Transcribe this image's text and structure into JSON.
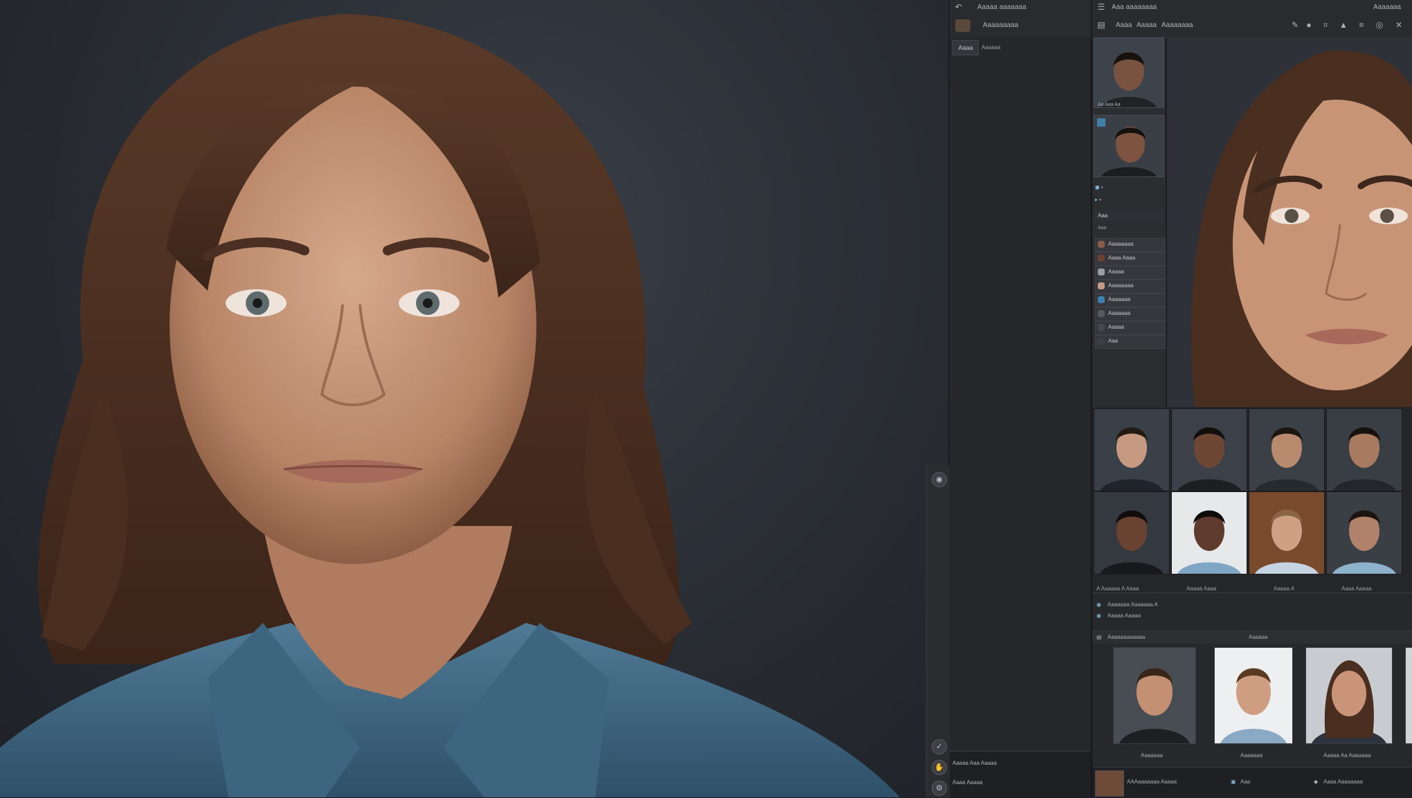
{
  "topbar_left": {
    "title": "Aaaaa aaaaaaa",
    "subtitle": "Aaaaaaaaa"
  },
  "topbar_right": {
    "title": "Aaa aaaaaaaa",
    "tab_1": "Aaaa",
    "tab_2": "Aaaaa",
    "tab_3": "Aaaaaaaa",
    "right_text": "Aaaaaaa"
  },
  "side_panel": {
    "tab_label": "Aaaa",
    "tab_caption": "Aaaaaa",
    "footer_line1": "Aaaaa Aaa Aaaaa",
    "footer_line2": "Aaaa Aaaaa"
  },
  "thumb_col": {
    "thumb1_caption": "Aa Aaa Aa",
    "list_header": "Aaa",
    "list_sub": "Aaa",
    "list_items": [
      "Aaaaaaaa",
      "Aaaa Aaaa",
      "Aaaaa",
      "Aaaaaaaa",
      "Aaaaaaa",
      "Aaaaaaa",
      "Aaaaa",
      "Aaa"
    ]
  },
  "face_grid": {
    "captions": [
      "A Aaaaaa A Aaaa",
      "Aaaaa Aaaa",
      "Aaaaa A",
      "Aaaa Aaaaa"
    ]
  },
  "lower_panel": {
    "info_line1": "Aaaaaaa Aaaaaaa A",
    "info_line2": "Aaaaa Aaaaa",
    "section_title": "Aaaaaaaaaaaa",
    "section_center": "Aaaaaa",
    "card_captions": [
      "Aaaaaaa",
      "Aaaaaaa",
      "Aaaaa Aa Aaaaaaa"
    ],
    "bottom_text": "AAAaaaaaaa Aaaaa",
    "bottom_mid": "Aaa",
    "bottom_right": "Aaaa Aaaaaaaa"
  },
  "colors": {
    "accent": "#e06a2c",
    "panel": "#26272b",
    "bar": "#2a2b2f"
  }
}
